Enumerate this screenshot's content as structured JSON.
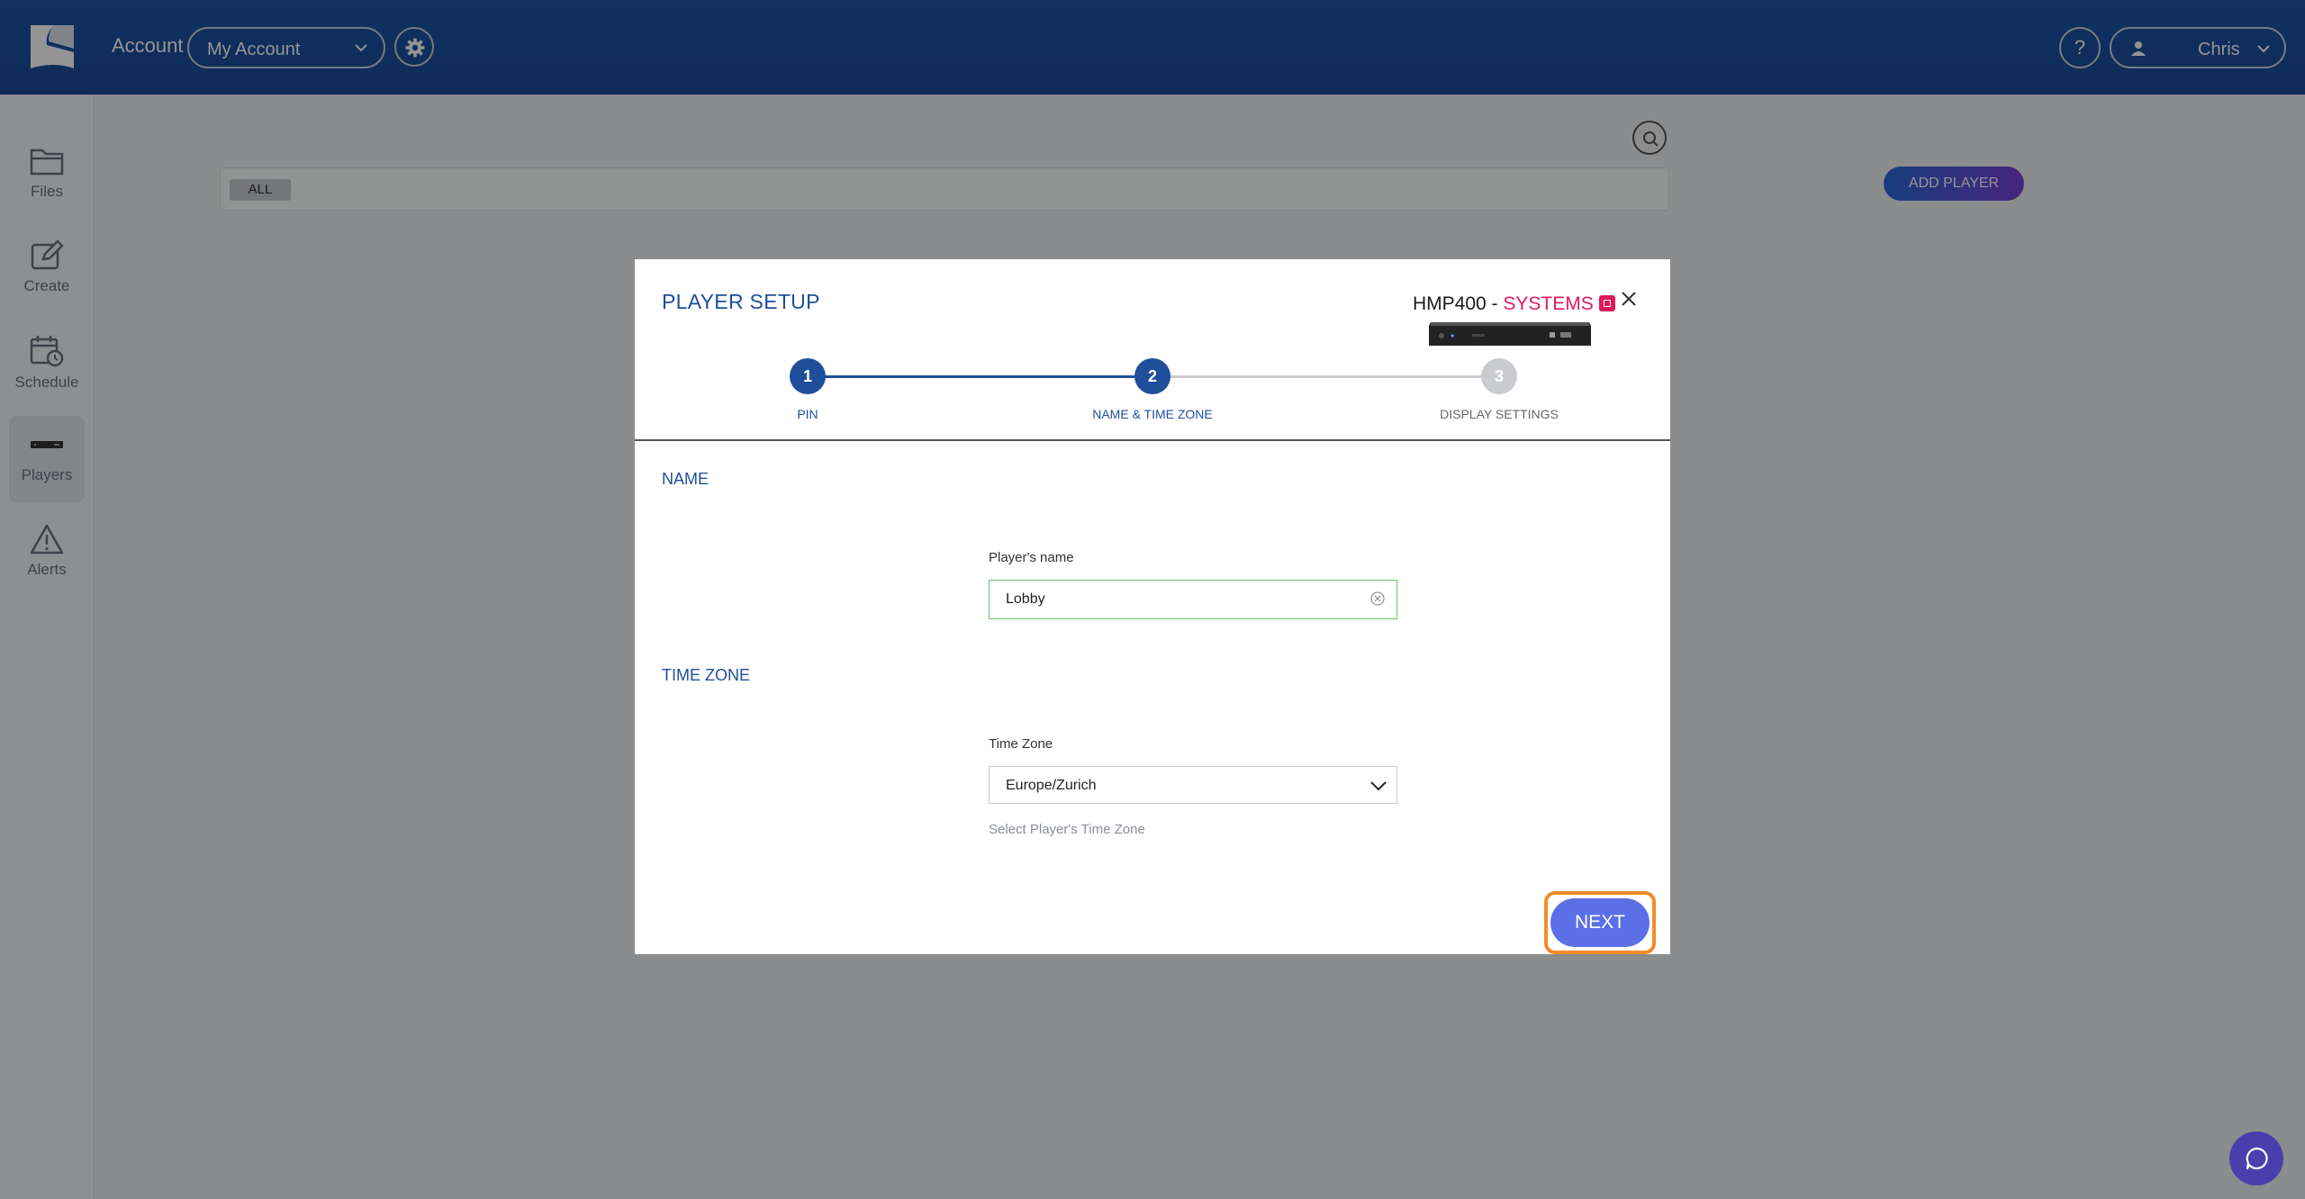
{
  "header": {
    "account_label": "Account",
    "account_select": "My Account",
    "help_label": "?",
    "user_name": "Chris"
  },
  "sidebar": {
    "items": [
      {
        "label": "Files",
        "icon": "folder-icon"
      },
      {
        "label": "Create",
        "icon": "edit-icon"
      },
      {
        "label": "Schedule",
        "icon": "calendar-clock-icon"
      },
      {
        "label": "Players",
        "icon": "player-device-icon"
      },
      {
        "label": "Alerts",
        "icon": "warning-icon"
      }
    ]
  },
  "main": {
    "filter_all": "ALL",
    "add_player": "ADD PLAYER"
  },
  "modal": {
    "title": "PLAYER SETUP",
    "device_model": "HMP400 - ",
    "device_brand": "SYSTEMS",
    "steps": [
      {
        "number": "1",
        "label": "PIN"
      },
      {
        "number": "2",
        "label": "NAME & TIME ZONE"
      },
      {
        "number": "3",
        "label": "DISPLAY SETTINGS"
      }
    ],
    "name_section": "NAME",
    "name_label": "Player's name",
    "name_value": "Lobby",
    "tz_section": "TIME ZONE",
    "tz_label": "Time Zone",
    "tz_value": "Europe/Zurich",
    "tz_help": "Select Player's Time Zone",
    "next_label": "NEXT"
  },
  "colors": {
    "header_blue": "#1e56a8",
    "accent_blue": "#1f4e9a",
    "brand_pink": "#e0195c",
    "next_button": "#5b6fe6",
    "highlight_orange": "#f28c28"
  }
}
